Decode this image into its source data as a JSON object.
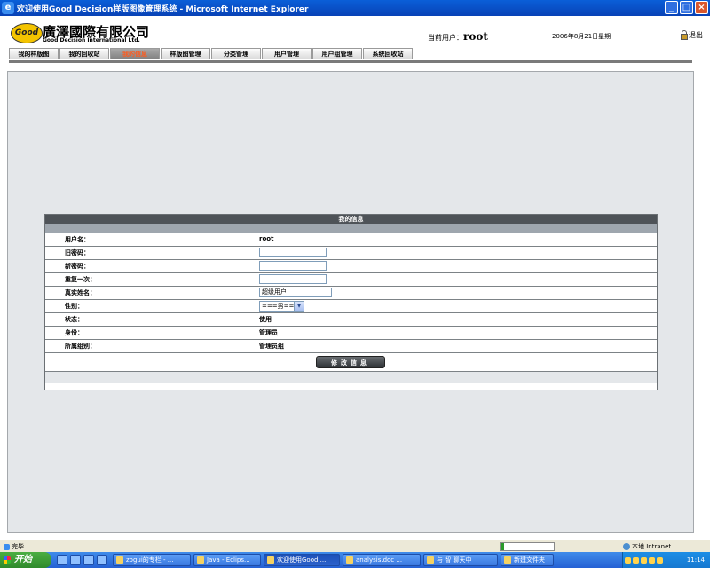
{
  "window": {
    "title": "欢迎使用Good Decision样版图像管理系统 - Microsoft Internet Explorer"
  },
  "header": {
    "logo_text": "Good",
    "company_name": "廣澤國際有限公司",
    "company_name_en": "Good Decision International Ltd.",
    "current_user_label": "当前用户：",
    "current_user": "root",
    "date": "2006年8月21日星期一",
    "logout_label": "退出"
  },
  "nav": {
    "tabs": [
      {
        "label": "我的样版图"
      },
      {
        "label": "我的回收站"
      },
      {
        "label": "我的信息"
      },
      {
        "label": "样版图管理"
      },
      {
        "label": "分类管理"
      },
      {
        "label": "用户管理"
      },
      {
        "label": "用户组管理"
      },
      {
        "label": "系统回收站"
      }
    ]
  },
  "panel": {
    "title": "我的信息",
    "fields": {
      "username_label": "用户名：",
      "username_value": "root",
      "old_password_label": "旧密码：",
      "new_password_label": "新密码：",
      "repeat_label": "重复一次：",
      "realname_label": "真实姓名：",
      "realname_value": "超级用户",
      "gender_label": "性别：",
      "gender_value": "===男===",
      "status_label": "状态：",
      "status_value": "使用",
      "role_label": "身份：",
      "role_value": "管理员",
      "group_label": "所属组别：",
      "group_value": "管理员组"
    },
    "submit_label": "修改信息"
  },
  "statusbar": {
    "status_text": "完毕",
    "progress": 0.07,
    "zone_text": "本地 Intranet"
  },
  "taskbar": {
    "start_label": "开始",
    "tasks": [
      {
        "label": "zogui的专栏 - ..."
      },
      {
        "label": "Java - Eclips..."
      },
      {
        "label": "欢迎使用Good ..."
      },
      {
        "label": "analysis.doc ..."
      },
      {
        "label": "与 智 聊天中"
      },
      {
        "label": "新建文件夹"
      }
    ],
    "clock": "11:14"
  }
}
